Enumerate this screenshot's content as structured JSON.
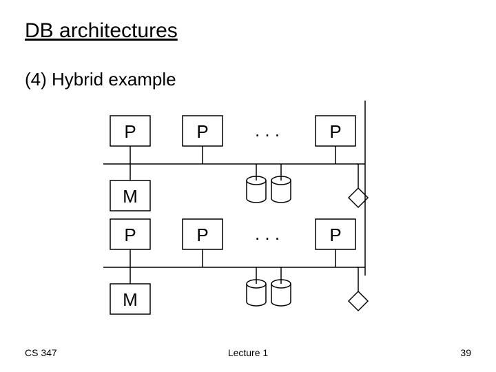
{
  "title": "DB architectures",
  "subtitle": "(4) Hybrid example",
  "footer": {
    "left": "CS 347",
    "center": "Lecture 1",
    "right": "39"
  },
  "labels": {
    "P": "P",
    "M": "M",
    "dots": ". . ."
  }
}
